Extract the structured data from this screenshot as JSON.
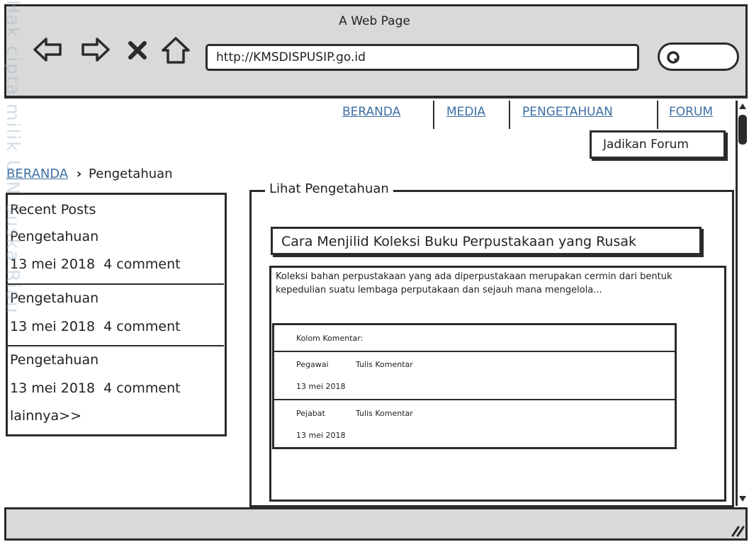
{
  "window": {
    "title": "A Web Page"
  },
  "browser": {
    "url": "http://KMSDISPUSIP.go.id"
  },
  "watermark": "Hak cipta milik UIN Suska Riau",
  "nav": [
    "BERANDA",
    "MEDIA",
    "PENGETAHUAN",
    "FORUM"
  ],
  "forum_button": "Jadikan Forum",
  "breadcrumb": {
    "home": "BERANDA",
    "sep": "›",
    "current": "Pengetahuan"
  },
  "sidebar": {
    "title": "Recent Posts",
    "posts": [
      {
        "title": "Pengetahuan",
        "meta": "13 mei 2018  4 comment"
      },
      {
        "title": "Pengetahuan",
        "meta": "13 mei 2018  4 comment"
      },
      {
        "title": "Pengetahuan",
        "meta": "13 mei 2018  4 comment"
      }
    ],
    "more": "lainnya>>"
  },
  "main": {
    "legend": "Lihat Pengetahuan",
    "article_title": "Cara Menjilid Koleksi Buku Perpustakaan yang Rusak",
    "excerpt": "Koleksi bahan perpustakaan yang ada diperpustakaan merupakan cermin dari bentuk kepedulian suatu lembaga perputakaan dan sejauh mana mengelola...",
    "comments": {
      "label": "Kolom Komentar:",
      "items": [
        {
          "user": "Pegawai",
          "action": "Tulis Komentar",
          "date": "13 mei 2018"
        },
        {
          "user": "Pejabat",
          "action": "Tulis Komentar",
          "date": "13 mei 2018"
        }
      ]
    }
  },
  "colors": {
    "link": "#3e6fa3",
    "chrome": "#d9d9d9",
    "ink": "#2b2b2b",
    "watermark": "#9fb6c4"
  }
}
